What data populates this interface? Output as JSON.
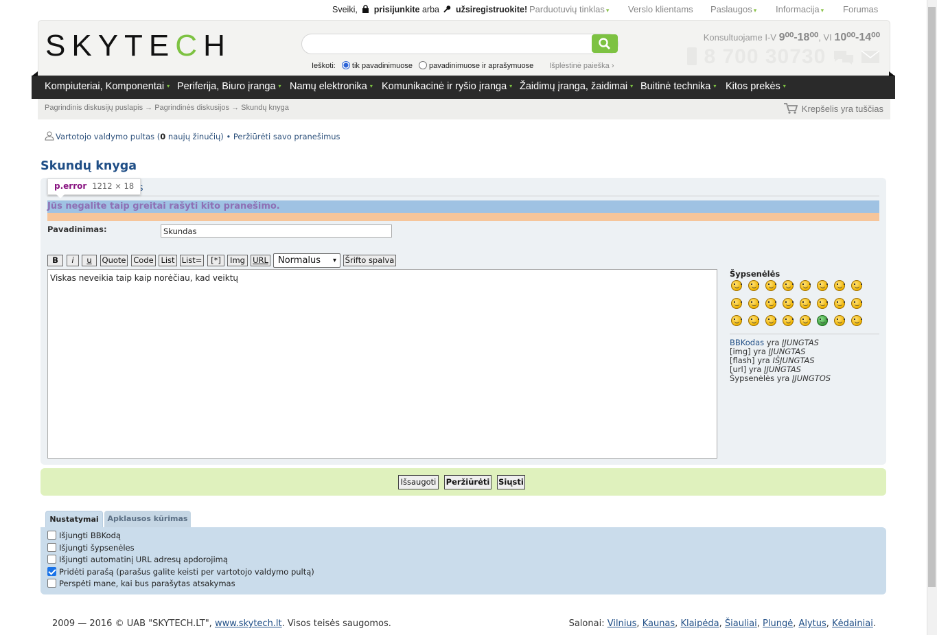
{
  "top": {
    "greeting": "Sveiki,",
    "login": "prisijunkite",
    "or": "arba",
    "register": "užsiregistruokite!",
    "nav": [
      "Parduotuvių tinklas",
      "Verslo klientams",
      "Paslaugos",
      "Informacija",
      "Forumas"
    ]
  },
  "header": {
    "logo": "SKYTECH",
    "search": {
      "value": "",
      "label": "Ieškoti:",
      "opt1": "tik pavadinimuose",
      "opt2": "pavadinimuose ir aprašymuose",
      "advanced": "Išplėstinė paieška ›"
    },
    "contact": {
      "prefix": "Konsultuojame I-V",
      "hours1": "9⁰⁰-18⁰⁰",
      "sat": ", VI",
      "hours2": "10⁰⁰-14⁰⁰",
      "phone": "8 700 30730"
    }
  },
  "menu": [
    "Kompiuteriai, Komponentai",
    "Periferija, Biuro įranga",
    "Namų elektronika",
    "Komunikacinė ir ryšio įranga",
    "Žaidimų įranga, žaidimai",
    "Buitinė technika",
    "Kitos prekės"
  ],
  "breadcrumb": "Pagrindinis diskusijų puslapis → Pagrindinės diskusijos → Skundų knyga",
  "cart": "Krepšelis yra tuščias",
  "ucp": {
    "prefix": "Vartotojo valdymo pultas (",
    "count": "0",
    "suffix": " naujų žinučių) •",
    "view": "Peržiūrėti savo pranešimus"
  },
  "page_title": "Skundų knyga",
  "tooltip": {
    "tag": "p.error",
    "size": "1212 × 18"
  },
  "partial_label": "AS",
  "error": "Jūs negalite taip greitai rašyti kito pranešimo.",
  "form": {
    "title_label": "Pavadinimas:",
    "title_value": "Skundas",
    "bb_buttons": [
      "B",
      "i",
      "u",
      "Quote",
      "Code",
      "List",
      "List=",
      "[*]",
      "Img",
      "URL"
    ],
    "font_size": "Normalus",
    "font_color": "Šrifto spalva",
    "message": "Viskas neveikia taip kaip norėčiau, kad veiktų"
  },
  "smilies": {
    "title": "Šypsenėlės",
    "icons": [
      "biggrin-icon",
      "smile-icon",
      "wink-icon",
      "surprised-icon",
      "shocked-icon",
      "confused-icon",
      "confused2-icon",
      "cool-icon",
      "laugh-icon",
      "mad-icon",
      "razz-icon",
      "redface-icon",
      "cry-icon",
      "evil-icon",
      "twisted-icon",
      "rolleyes-icon",
      "exclaim-icon",
      "question-icon",
      "idea-icon",
      "arrow-icon",
      "neutral-icon",
      "green-icon",
      "geek-icon",
      "ugeek-icon"
    ]
  },
  "bbinfo": [
    {
      "name": "BBKodas",
      "state": "ĮJUNGTAS"
    },
    {
      "name": "[img]",
      "state": "ĮJUNGTAS"
    },
    {
      "name": "[flash]",
      "state": "IŠJUNGTAS"
    },
    {
      "name": "[url]",
      "state": "ĮJUNGTAS"
    },
    {
      "name": "Šypsenėlės",
      "state": "ĮJUNGTOS"
    }
  ],
  "bbinfo_verb": "yra",
  "buttons": {
    "save": "Išsaugoti",
    "preview": "Peržiūrėti",
    "submit": "Siųsti"
  },
  "tabs": [
    "Nustatymai",
    "Apklausos kūrimas"
  ],
  "options": [
    {
      "label": "Išjungti BBKodą",
      "checked": false
    },
    {
      "label": "Išjungti šypsenėles",
      "checked": false
    },
    {
      "label": "Išjungti automatinį URL adresų apdorojimą",
      "checked": false
    },
    {
      "label": "Pridėti parašą (parašus galite keisti per vartotojo valdymo pultą)",
      "checked": true
    },
    {
      "label": "Perspėti mane, kai bus parašytas atsakymas",
      "checked": false
    }
  ],
  "footer": {
    "copy": "2009 — 2016 © UAB \"SKYTECH.LT\",",
    "site": "www.skytech.lt",
    "rights": ". Visos teisės saugomos.",
    "salons_label": "Salonai:",
    "salons": [
      "Vilnius",
      "Kaunas",
      "Klaipėda",
      "Šiauliai",
      "Plungė",
      "Alytus",
      "Kėdainiai"
    ]
  },
  "colors": {
    "accent": "#7dc242",
    "menu": "#2a2a2a",
    "title": "#1f4e86"
  }
}
